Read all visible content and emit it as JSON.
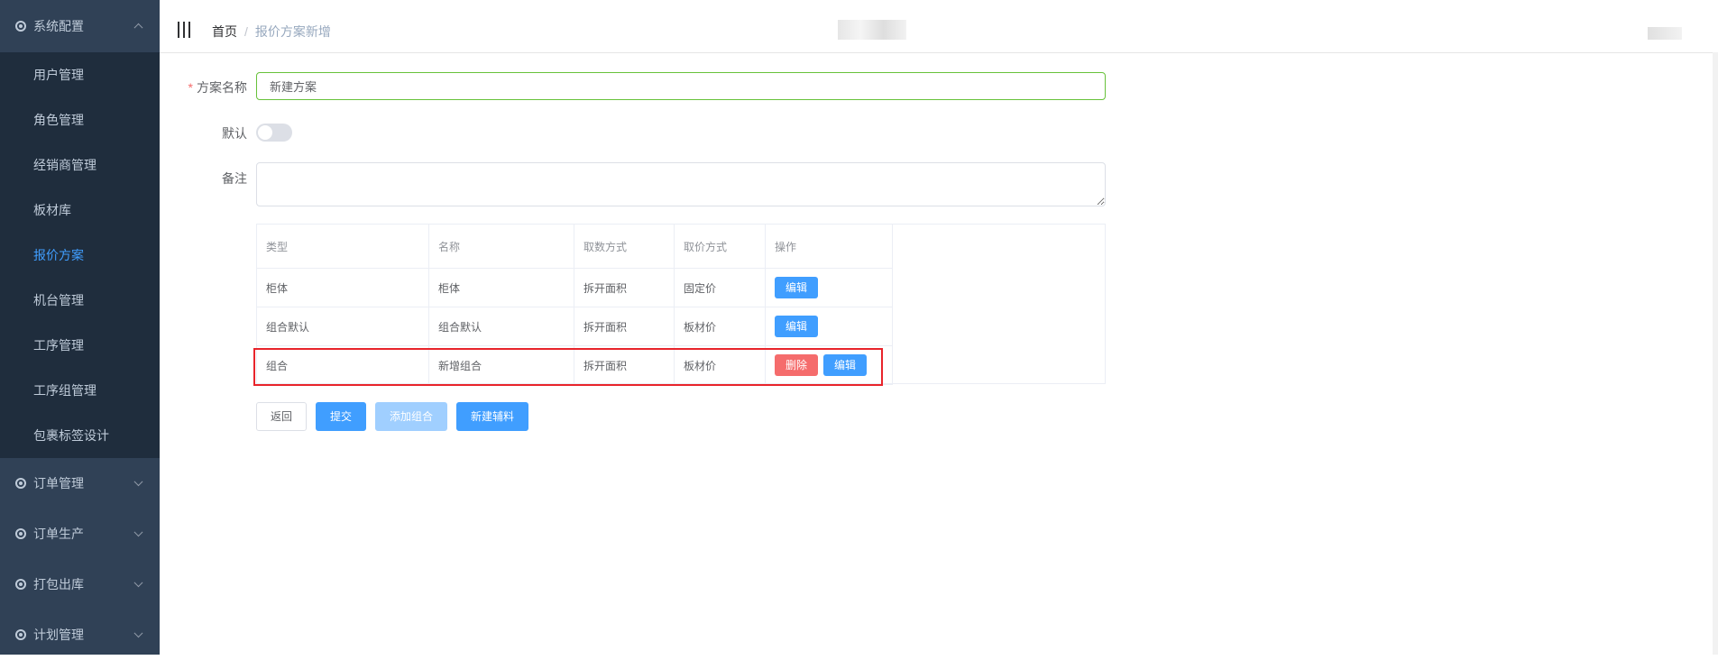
{
  "sidebar": {
    "top_group": {
      "label": "系统配置",
      "icon": "gear-icon",
      "expanded": true
    },
    "items": [
      {
        "label": "用户管理",
        "active": false
      },
      {
        "label": "角色管理",
        "active": false
      },
      {
        "label": "经销商管理",
        "active": false
      },
      {
        "label": "板材库",
        "active": false
      },
      {
        "label": "报价方案",
        "active": true
      },
      {
        "label": "机台管理",
        "active": false
      },
      {
        "label": "工序管理",
        "active": false
      },
      {
        "label": "工序组管理",
        "active": false
      },
      {
        "label": "包裹标签设计",
        "active": false
      }
    ],
    "groups": [
      {
        "label": "订单管理"
      },
      {
        "label": "订单生产"
      },
      {
        "label": "打包出库"
      },
      {
        "label": "计划管理"
      }
    ]
  },
  "breadcrumb": {
    "home": "首页",
    "separator": "/",
    "current": "报价方案新增"
  },
  "form": {
    "name_label": "方案名称",
    "required_mark": "*",
    "name_value": "新建方案",
    "default_label": "默认",
    "default_on": false,
    "remark_label": "备注",
    "remark_value": ""
  },
  "table": {
    "headers": [
      "类型",
      "名称",
      "取数方式",
      "取价方式",
      "操作"
    ],
    "rows": [
      {
        "type": "柜体",
        "name": "柜体",
        "count_mode": "拆开面积",
        "price_mode": "固定价",
        "delete": "",
        "edit": "编辑"
      },
      {
        "type": "组合默认",
        "name": "组合默认",
        "count_mode": "拆开面积",
        "price_mode": "板材价",
        "delete": "",
        "edit": "编辑"
      },
      {
        "type": "组合",
        "name": "新增组合",
        "count_mode": "拆开面积",
        "price_mode": "板材价",
        "delete": "删除",
        "edit": "编辑"
      }
    ]
  },
  "actions": {
    "back": "返回",
    "submit": "提交",
    "add_combo": "添加组合",
    "new_accessory": "新建辅料"
  },
  "colors": {
    "sidebar_bg": "#304156",
    "submenu_bg": "#1f2d3d",
    "active": "#409eff",
    "danger": "#f56c6c",
    "highlight": "#e8242b",
    "valid": "#67c23a"
  }
}
